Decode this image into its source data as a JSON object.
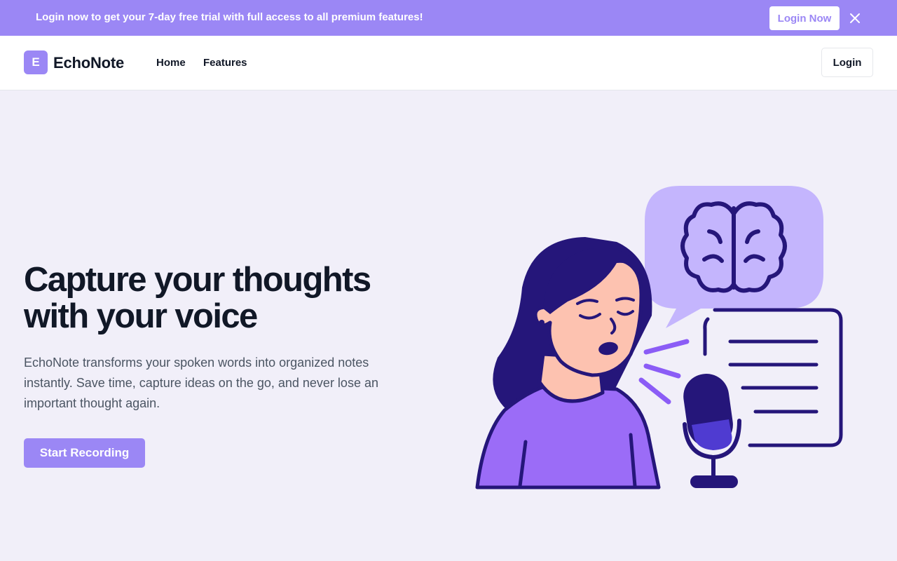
{
  "banner": {
    "text": "Login now to get your 7-day free trial with full access to all premium features!",
    "cta_label": "Login Now",
    "close_icon": "close-icon"
  },
  "navbar": {
    "logo_letter": "E",
    "brand": "EchoNote",
    "links": [
      "Home",
      "Features"
    ],
    "login_label": "Login"
  },
  "hero": {
    "title": "Capture your thoughts with your voice",
    "description": "EchoNote transforms your spoken words into organized notes instantly. Save time, capture ideas on the go, and never lose an important thought again.",
    "cta_label": "Start Recording"
  },
  "colors": {
    "accent": "#9b87f5",
    "dark_purple": "#25167a",
    "bubble": "#c4b5fd",
    "background": "#f1eff9"
  }
}
